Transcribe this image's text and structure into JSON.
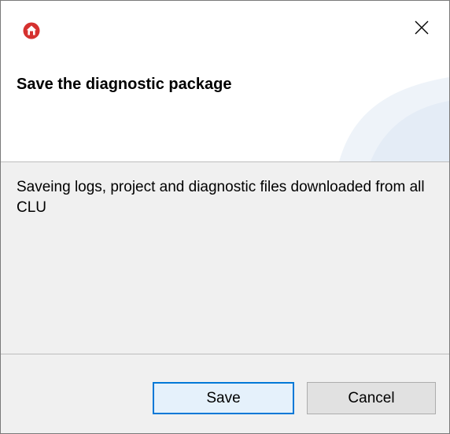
{
  "window": {
    "icon": "red-home-icon",
    "close_icon": "close-icon"
  },
  "header": {
    "title": "Save the diagnostic package"
  },
  "body": {
    "message": "Saveing logs, project and diagnostic files downloaded from all CLU"
  },
  "buttons": {
    "save_label": "Save",
    "cancel_label": "Cancel"
  },
  "colors": {
    "accent": "#0078d7",
    "app_icon": "#d5312f"
  }
}
